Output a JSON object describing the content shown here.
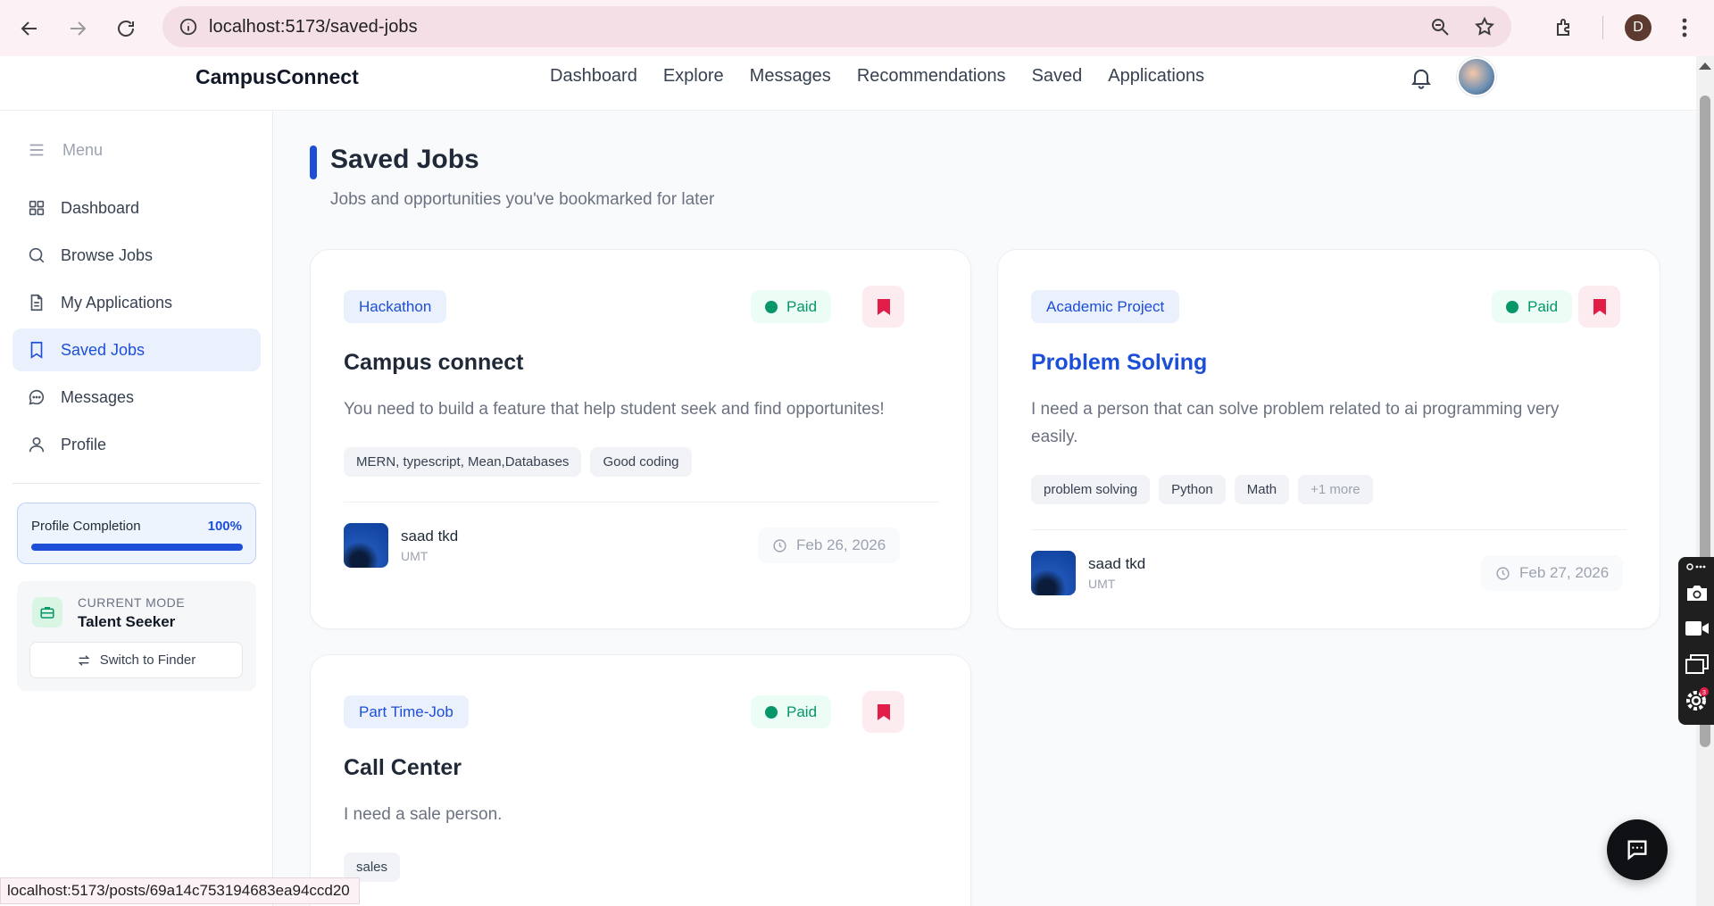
{
  "browser": {
    "url": "localhost:5173/saved-jobs",
    "profile_initial": "D",
    "status_url": "localhost:5173/posts/69a14c753194683ea94ccd20"
  },
  "header": {
    "brand": "CampusConnect",
    "nav": [
      "Dashboard",
      "Explore",
      "Messages",
      "Recommendations",
      "Saved",
      "Applications"
    ]
  },
  "sidebar": {
    "menu_label": "Menu",
    "items": [
      {
        "label": "Dashboard",
        "icon": "grid-icon"
      },
      {
        "label": "Browse Jobs",
        "icon": "search-icon"
      },
      {
        "label": "My Applications",
        "icon": "document-icon"
      },
      {
        "label": "Saved Jobs",
        "icon": "bookmark-icon",
        "active": true
      },
      {
        "label": "Messages",
        "icon": "chat-icon"
      },
      {
        "label": "Profile",
        "icon": "user-icon"
      }
    ],
    "completion": {
      "label": "Profile Completion",
      "percent_text": "100%",
      "value": 1.0
    },
    "mode": {
      "caption": "CURRENT MODE",
      "value": "Talent Seeker",
      "switch_label": "Switch to Finder"
    }
  },
  "page": {
    "title": "Saved Jobs",
    "subtitle": "Jobs and opportunities you've bookmarked for later"
  },
  "jobs": [
    {
      "category": "Hackathon",
      "paid": "Paid",
      "title": "Campus connect",
      "description": "You need to build a feature that help student seek and find opportunites!",
      "tags": [
        "MERN, typescript, Mean,Databases",
        "Good coding"
      ],
      "poster": "saad tkd",
      "org": "UMT",
      "date": "Feb 26, 2026"
    },
    {
      "category": "Academic Project",
      "paid": "Paid",
      "title": "Problem Solving",
      "description_lines": [
        "I need a person that can solve problem related to ai programming very",
        "easily."
      ],
      "tags": [
        "problem solving",
        "Python",
        "Math"
      ],
      "more_tag": "+1 more",
      "poster": "saad tkd",
      "org": "UMT",
      "date": "Feb 27, 2026"
    },
    {
      "category": "Part Time-Job",
      "paid": "Paid",
      "title": "Call Center",
      "description": "I need a sale person.",
      "tags": [
        "sales"
      ]
    }
  ],
  "colors": {
    "accent": "#1d4ed8",
    "paid_green": "#059669",
    "bookmark_red": "#e11d48",
    "page_bg": "#f8fafc"
  }
}
